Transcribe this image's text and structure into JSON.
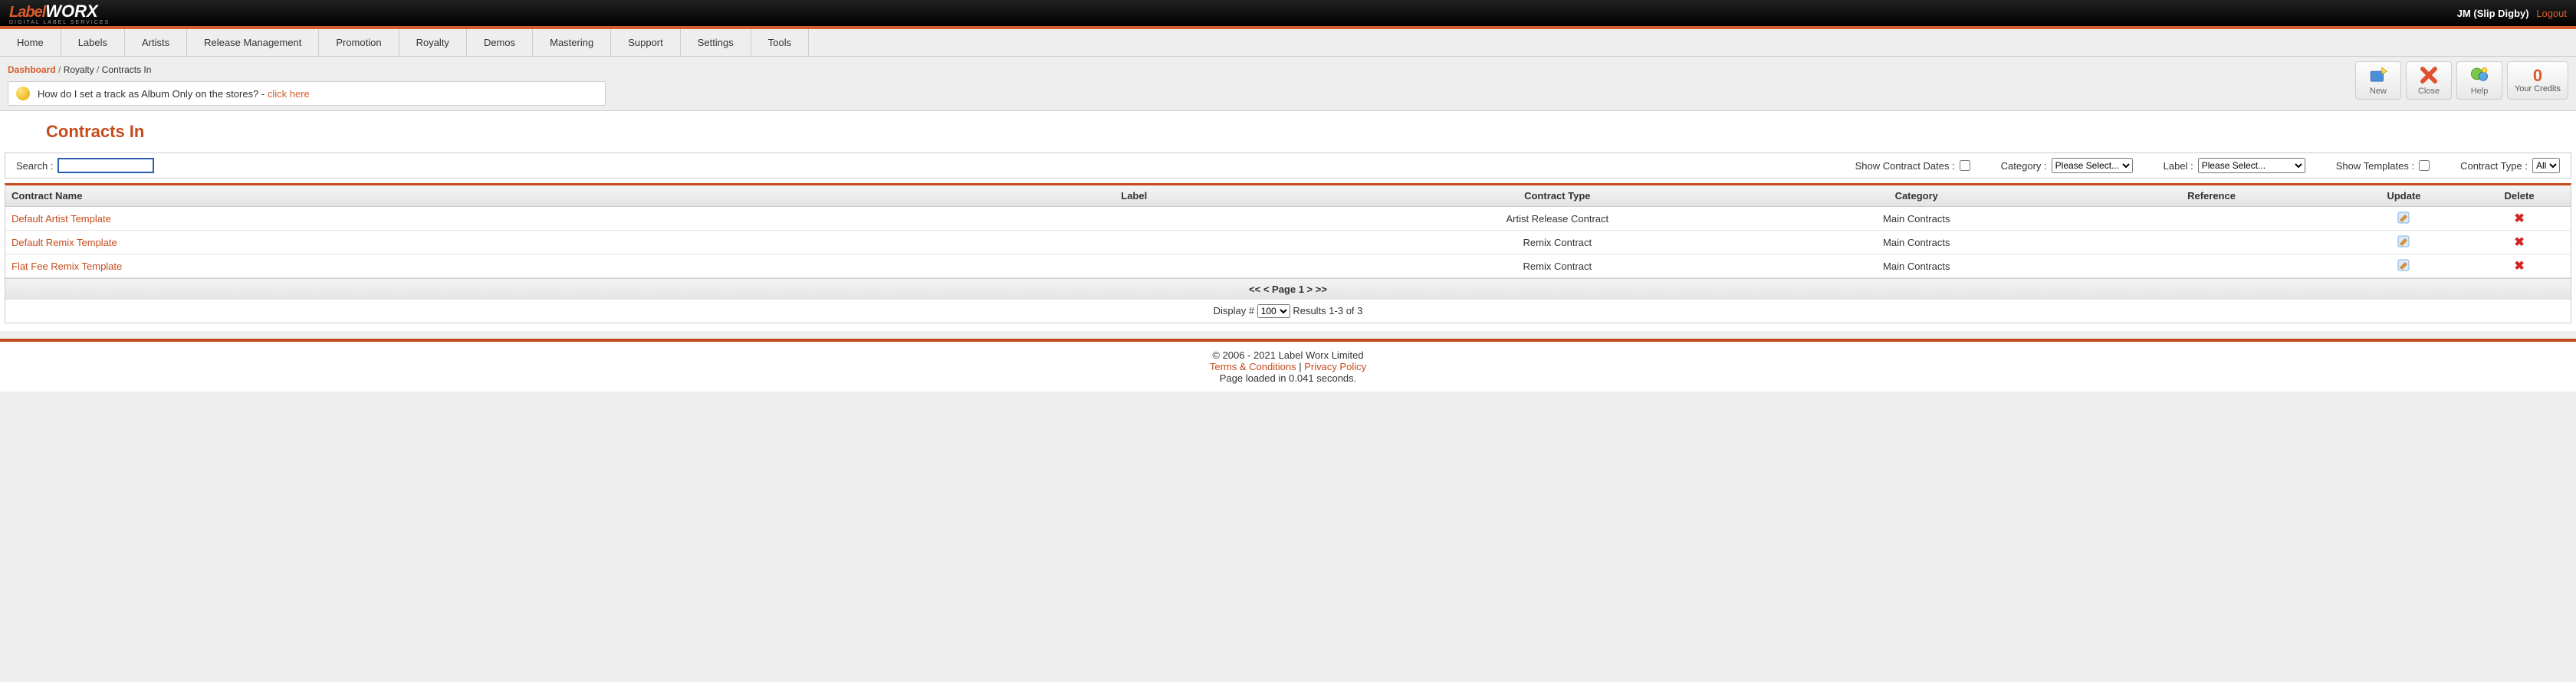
{
  "header": {
    "logo_label": "Label",
    "logo_worx": "WORX",
    "logo_sub": "DIGITAL LABEL SERVICES",
    "user": "JM (Slip Digby)",
    "logout": "Logout"
  },
  "nav": [
    "Home",
    "Labels",
    "Artists",
    "Release Management",
    "Promotion",
    "Royalty",
    "Demos",
    "Mastering",
    "Support",
    "Settings",
    "Tools"
  ],
  "breadcrumb": {
    "dashboard": "Dashboard",
    "sep1": " / ",
    "royalty": "Royalty",
    "sep2": " / ",
    "page": "Contracts In"
  },
  "helpbox": {
    "text": "How do I set a track as Album Only on the stores? - ",
    "link": "click here"
  },
  "toolbar": {
    "new": "New",
    "close": "Close",
    "help": "Help",
    "credits_num": "0",
    "credits_label": "Your Credits"
  },
  "page_title": "Contracts In",
  "filters": {
    "search_label": "Search :",
    "show_dates_label": "Show Contract Dates :",
    "category_label": "Category :",
    "category_selected": "Please Select...",
    "label_label": "Label :",
    "label_selected": "Please Select...",
    "show_templates_label": "Show Templates :",
    "contract_type_label": "Contract Type :",
    "contract_type_selected": "All"
  },
  "table": {
    "headers": [
      "Contract Name",
      "Label",
      "Contract Type",
      "Category",
      "Reference",
      "Update",
      "Delete"
    ],
    "rows": [
      {
        "name": "Default Artist Template",
        "label": "",
        "type": "Artist Release Contract",
        "category": "Main Contracts",
        "reference": ""
      },
      {
        "name": "Default Remix Template",
        "label": "",
        "type": "Remix Contract",
        "category": "Main Contracts",
        "reference": ""
      },
      {
        "name": "Flat Fee Remix Template",
        "label": "",
        "type": "Remix Contract",
        "category": "Main Contracts",
        "reference": ""
      }
    ]
  },
  "pager": "<< < Page 1 > >>",
  "display": {
    "label": "Display #",
    "value": "100",
    "results": "Results 1-3 of 3"
  },
  "footer": {
    "copyright": "© 2006 - 2021 Label Worx Limited",
    "terms": "Terms & Conditions",
    "sep": " | ",
    "privacy": "Privacy Policy",
    "loaded": "Page loaded in 0.041 seconds."
  }
}
